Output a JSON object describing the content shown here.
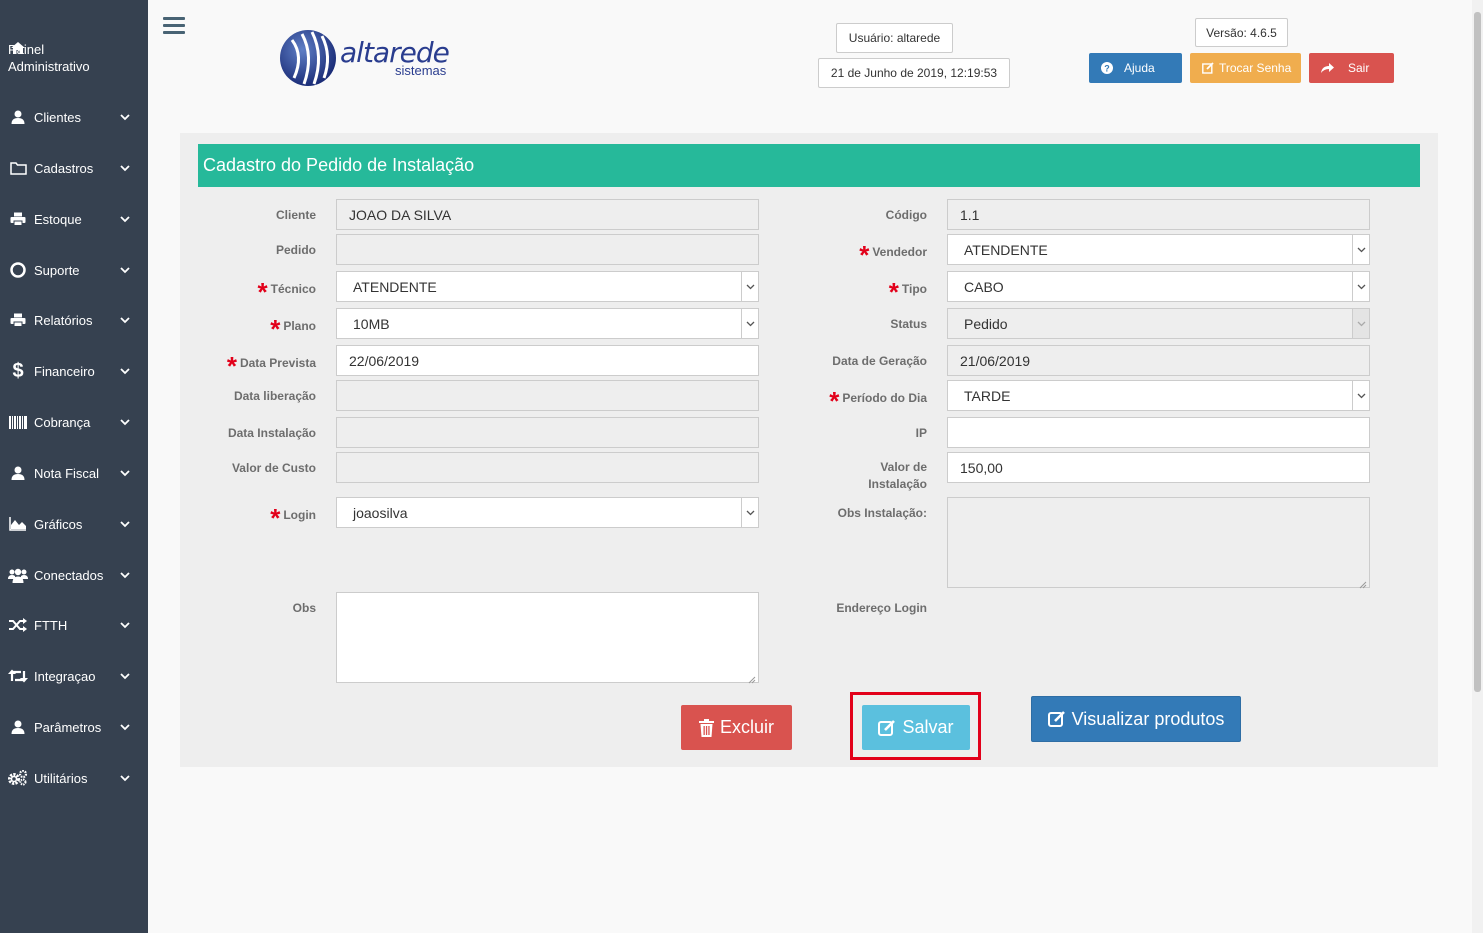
{
  "sidebar": {
    "items": [
      {
        "label": "Painel\nAdministrativo",
        "icon": "home-icon"
      },
      {
        "label": "Clientes",
        "icon": "user-icon"
      },
      {
        "label": "Cadastros",
        "icon": "folder-icon"
      },
      {
        "label": "Estoque",
        "icon": "printer-icon"
      },
      {
        "label": "Suporte",
        "icon": "lifebuoy-icon"
      },
      {
        "label": "Relatórios",
        "icon": "printer-icon"
      },
      {
        "label": "Financeiro",
        "icon": "dollar-icon"
      },
      {
        "label": "Cobrança",
        "icon": "barcode-icon"
      },
      {
        "label": "Nota Fiscal",
        "icon": "user-icon"
      },
      {
        "label": "Gráficos",
        "icon": "area-chart-icon"
      },
      {
        "label": "Conectados",
        "icon": "users-icon"
      },
      {
        "label": "FTTH",
        "icon": "random-icon"
      },
      {
        "label": "Integraçao",
        "icon": "retweet-icon"
      },
      {
        "label": "Parâmetros",
        "icon": "user-icon"
      },
      {
        "label": "Utilitários",
        "icon": "cogs-icon"
      }
    ]
  },
  "header": {
    "logo_name": "altarede",
    "logo_sub": "sistemas",
    "user": "Usuário: altarede",
    "datetime": "21 de Junho de 2019, 12:19:53",
    "version": "Versão: 4.6.5",
    "help_label": "Ajuda",
    "change_password_label": "Trocar Senha",
    "logout_label": "Sair"
  },
  "colors": {
    "sidebar": "#364150",
    "title_bar": "#26b99a",
    "required": "#e2001a",
    "btn_help": "#337ab7",
    "btn_password": "#f0ad4e",
    "btn_logout": "#d9534f",
    "btn_save": "#5bc0de"
  },
  "form": {
    "title": "Cadastro do Pedido de Instalação",
    "left": {
      "cliente": {
        "label": "Cliente",
        "value": "JOAO DA SILVA"
      },
      "pedido": {
        "label": "Pedido",
        "value": ""
      },
      "tecnico": {
        "label": "Técnico",
        "value": "ATENDENTE"
      },
      "plano": {
        "label": "Plano",
        "value": "10MB"
      },
      "data_prevista": {
        "label": "Data Prevista",
        "value": "22/06/2019"
      },
      "data_liberacao": {
        "label": "Data liberação",
        "value": ""
      },
      "data_instalacao": {
        "label": "Data Instalação",
        "value": ""
      },
      "valor_custo": {
        "label": "Valor de Custo",
        "value": ""
      },
      "login": {
        "label": "Login",
        "value": "joaosilva"
      },
      "obs": {
        "label": "Obs",
        "value": ""
      }
    },
    "right": {
      "codigo": {
        "label": "Código",
        "value": "1.1"
      },
      "vendedor": {
        "label": "Vendedor",
        "value": "ATENDENTE"
      },
      "tipo": {
        "label": "Tipo",
        "value": "CABO"
      },
      "status": {
        "label": "Status",
        "value": "Pedido"
      },
      "data_geracao": {
        "label": "Data de Geração",
        "value": "21/06/2019"
      },
      "periodo": {
        "label": "Período do Dia",
        "value": "TARDE"
      },
      "ip": {
        "label": "IP",
        "value": ""
      },
      "valor_instalacao": {
        "label": "Valor de\nInstalação",
        "value": "150,00"
      },
      "obs_instalacao": {
        "label": "Obs Instalação:",
        "value": ""
      },
      "endereco_login": {
        "label": "Endereço Login"
      }
    },
    "buttons": {
      "delete": "Excluir",
      "save": "Salvar",
      "view_products": "Visualizar produtos"
    }
  }
}
